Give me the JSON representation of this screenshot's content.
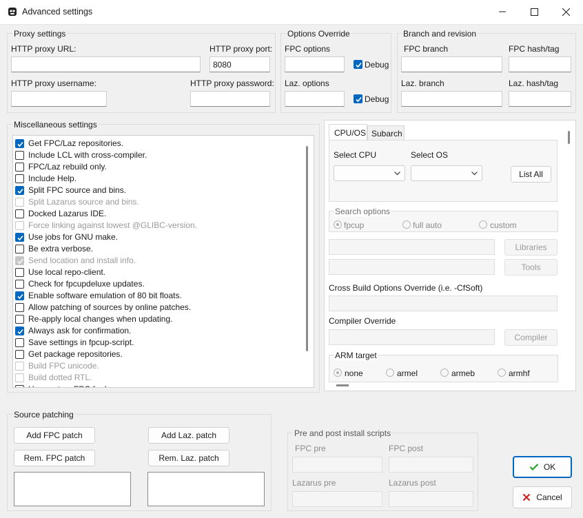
{
  "window": {
    "title": "Advanced settings"
  },
  "proxy": {
    "group": "Proxy settings",
    "url_label": "HTTP proxy URL:",
    "url_value": "",
    "port_label": "HTTP proxy port:",
    "port_value": "8080",
    "user_label": "HTTP proxy username:",
    "user_value": "",
    "pass_label": "HTTP proxy password:",
    "pass_value": ""
  },
  "options_override": {
    "group": "Options Override",
    "fpc_label": "FPC options",
    "laz_label": "Laz. options",
    "debug1": "Debug",
    "debug2": "Debug"
  },
  "branch": {
    "group": "Branch and revision",
    "fpc_branch": "FPC branch",
    "fpc_hash": "FPC hash/tag",
    "laz_branch": "Laz. branch",
    "laz_hash": "Laz. hash/tag"
  },
  "misc": {
    "group": "Miscellaneous settings",
    "items": [
      {
        "label": "Get FPC/Laz repositories.",
        "state": "on"
      },
      {
        "label": "Include LCL with cross-compiler.",
        "state": "off"
      },
      {
        "label": "FPC/Laz rebuild only.",
        "state": "off"
      },
      {
        "label": "Include Help.",
        "state": "off"
      },
      {
        "label": "Split FPC source and bins.",
        "state": "on"
      },
      {
        "label": "Split Lazarus source and bins.",
        "state": "off-dim"
      },
      {
        "label": "Docked Lazarus IDE.",
        "state": "off"
      },
      {
        "label": "Force linking against lowest @GLIBC-version.",
        "state": "off-dim"
      },
      {
        "label": "Use jobs for GNU make.",
        "state": "on"
      },
      {
        "label": "Be extra verbose.",
        "state": "off"
      },
      {
        "label": "Send location and install info.",
        "state": "on-dim"
      },
      {
        "label": "Use local repo-client.",
        "state": "off"
      },
      {
        "label": "Check for fpcupdeluxe updates.",
        "state": "off"
      },
      {
        "label": "Enable software emulation of 80 bit floats.",
        "state": "on"
      },
      {
        "label": "Allow patching of sources by online patches.",
        "state": "off"
      },
      {
        "label": "Re-apply local changes when updating.",
        "state": "off"
      },
      {
        "label": "Always ask for confirmation.",
        "state": "on"
      },
      {
        "label": "Save settings in fpcup-script.",
        "state": "off"
      },
      {
        "label": "Get package repositories.",
        "state": "off"
      },
      {
        "label": "Build FPC unicode.",
        "state": "off-dim"
      },
      {
        "label": "Build dotted RTL.",
        "state": "off-dim"
      },
      {
        "label": "Use system FPC for Lazarus.",
        "state": "off"
      }
    ]
  },
  "tabs": {
    "cpu_os": "CPU/OS",
    "subarch": "Subarch",
    "select_cpu": "Select CPU",
    "select_os": "Select OS",
    "list_all": "List All",
    "search_group": "Search options",
    "search_opts": [
      "fpcup",
      "full auto",
      "custom"
    ],
    "libraries": "Libraries",
    "tools": "Tools",
    "cross_build": "Cross Build Options Override (i.e. -CfSoft)",
    "compiler_override": "Compiler Override",
    "compiler": "Compiler",
    "arm_group": "ARM target",
    "arm_opts": [
      "none",
      "armel",
      "armeb",
      "armhf"
    ]
  },
  "source_patching": {
    "group": "Source patching",
    "add_fpc": "Add FPC patch",
    "add_laz": "Add Laz. patch",
    "rem_fpc": "Rem. FPC patch",
    "rem_laz": "Rem. Laz. patch"
  },
  "scripts": {
    "group": "Pre and post install scripts",
    "fpc_pre": "FPC pre",
    "fpc_post": "FPC post",
    "laz_pre": "Lazarus pre",
    "laz_post": "Lazarus post"
  },
  "buttons": {
    "ok": "OK",
    "cancel": "Cancel"
  },
  "colors": {
    "accent": "#0067c0",
    "ok_check": "#2aa12a",
    "cancel_x": "#d32222"
  }
}
